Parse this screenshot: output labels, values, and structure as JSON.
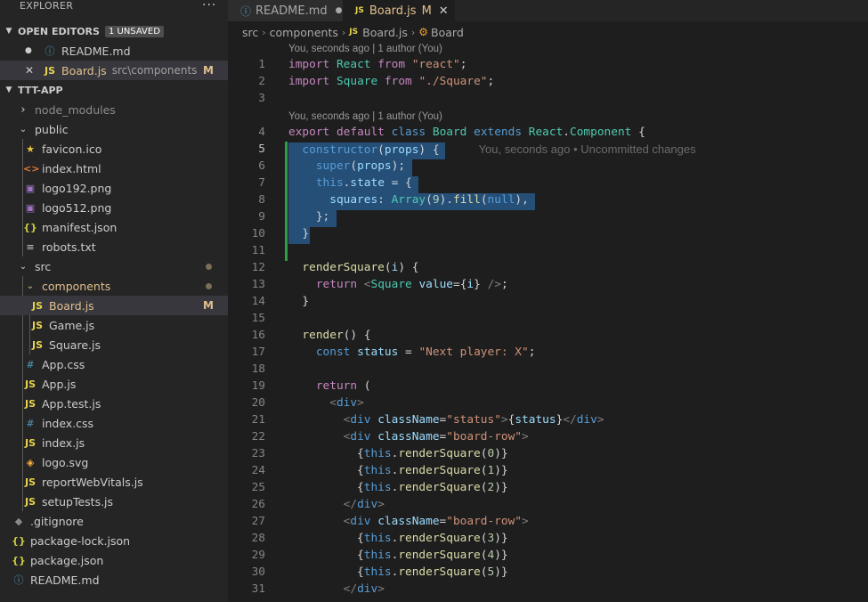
{
  "sidebar": {
    "title": "EXPLORER",
    "more": "···",
    "open_editors": {
      "label": "OPEN EDITORS",
      "badge": "1 UNSAVED"
    },
    "open_files": [
      {
        "name": "README.md",
        "indicator": "●"
      },
      {
        "name": "Board.js",
        "path": "src\\components",
        "indicator": "✕",
        "status": "M"
      }
    ],
    "project": {
      "label": "TTT-APP"
    },
    "tree": [
      {
        "name": "node_modules",
        "icon": "chevron-right"
      },
      {
        "name": "public",
        "icon": "chevron-down"
      },
      {
        "name": "favicon.ico",
        "icon": "star"
      },
      {
        "name": "index.html",
        "icon": "<>"
      },
      {
        "name": "logo192.png",
        "icon": "image"
      },
      {
        "name": "logo512.png",
        "icon": "image"
      },
      {
        "name": "manifest.json",
        "icon": "{}"
      },
      {
        "name": "robots.txt",
        "icon": "≡"
      },
      {
        "name": "src",
        "icon": "chevron-down"
      },
      {
        "name": "components",
        "icon": "chevron-down"
      },
      {
        "name": "Board.js",
        "icon": "JS",
        "status": "M"
      },
      {
        "name": "Game.js",
        "icon": "JS"
      },
      {
        "name": "Square.js",
        "icon": "JS"
      },
      {
        "name": "App.css",
        "icon": "#"
      },
      {
        "name": "App.js",
        "icon": "JS"
      },
      {
        "name": "App.test.js",
        "icon": "JS"
      },
      {
        "name": "index.css",
        "icon": "#"
      },
      {
        "name": "index.js",
        "icon": "JS"
      },
      {
        "name": "logo.svg",
        "icon": "svg"
      },
      {
        "name": "reportWebVitals.js",
        "icon": "JS"
      },
      {
        "name": "setupTests.js",
        "icon": "JS"
      },
      {
        "name": ".gitignore",
        "icon": "git"
      },
      {
        "name": "package-lock.json",
        "icon": "{}"
      },
      {
        "name": "package.json",
        "icon": "{}"
      },
      {
        "name": "README.md",
        "icon": "info"
      }
    ]
  },
  "tabs": [
    {
      "label": "README.md",
      "indicator": "●"
    },
    {
      "label": "Board.js",
      "status": "M",
      "indicator": "✕"
    }
  ],
  "breadcrumb": [
    "src",
    "components",
    "Board.js",
    "Board"
  ],
  "editor": {
    "codelens": [
      "You, seconds ago | 1 author (You)",
      "You, seconds ago | 1 author (You)"
    ],
    "blame": "You, seconds ago • Uncommitted changes",
    "line_numbers": [
      "1",
      "2",
      "3",
      "4",
      "5",
      "6",
      "7",
      "8",
      "9",
      "10",
      "11",
      "12",
      "13",
      "14",
      "15",
      "16",
      "17",
      "18",
      "19",
      "20",
      "21",
      "22",
      "23",
      "24",
      "25",
      "26",
      "27",
      "28",
      "29",
      "30",
      "31"
    ],
    "lines": [
      "import React from \"react\";",
      "import Square from \"./Square\";",
      "",
      "export default class Board extends React.Component {",
      "  constructor(props) {",
      "    super(props);",
      "    this.state = {",
      "      squares: Array(9).fill(null),",
      "    };",
      "  }",
      "",
      "  renderSquare(i) {",
      "    return <Square value={i} />;",
      "  }",
      "",
      "  render() {",
      "    const status = \"Next player: X\";",
      "",
      "    return (",
      "      <div>",
      "        <div className=\"status\">{status}</div>",
      "        <div className=\"board-row\">",
      "          {this.renderSquare(0)}",
      "          {this.renderSquare(1)}",
      "          {this.renderSquare(2)}",
      "        </div>",
      "        <div className=\"board-row\">",
      "          {this.renderSquare(3)}",
      "          {this.renderSquare(4)}",
      "          {this.renderSquare(5)}",
      "        </div>"
    ]
  }
}
